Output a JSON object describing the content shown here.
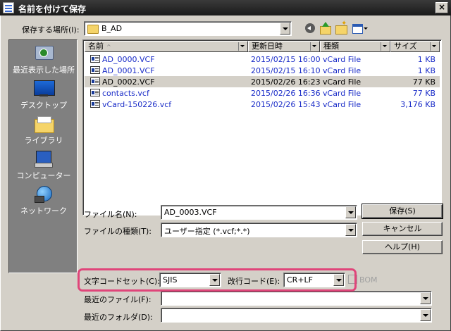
{
  "window": {
    "title": "名前を付けて保存",
    "close_glyph": "×"
  },
  "location": {
    "label": "保存する場所(I):",
    "value": "B_AD"
  },
  "places": [
    {
      "label": "最近表示した場所",
      "icon": "recent-places-icon"
    },
    {
      "label": "デスクトップ",
      "icon": "desktop-icon"
    },
    {
      "label": "ライブラリ",
      "icon": "library-icon"
    },
    {
      "label": "コンピューター",
      "icon": "computer-icon"
    },
    {
      "label": "ネットワーク",
      "icon": "network-icon"
    }
  ],
  "columns": {
    "name": "名前",
    "sort_glyph": "^",
    "modified": "更新日時",
    "type": "種類",
    "size": "サイズ"
  },
  "files": [
    {
      "name": "AD_0000.VCF",
      "modified": "2015/02/15 16:00",
      "type": "vCard File",
      "size": "1 KB",
      "selected": false
    },
    {
      "name": "AD_0001.VCF",
      "modified": "2015/02/15 16:10",
      "type": "vCard File",
      "size": "1 KB",
      "selected": false
    },
    {
      "name": "AD_0002.VCF",
      "modified": "2015/02/26 16:23",
      "type": "vCard File",
      "size": "77 KB",
      "selected": true
    },
    {
      "name": "contacts.vcf",
      "modified": "2015/02/26 16:36",
      "type": "vCard File",
      "size": "77 KB",
      "selected": false
    },
    {
      "name": "vCard-150226.vcf",
      "modified": "2015/02/26 15:43",
      "type": "vCard File",
      "size": "3,176 KB",
      "selected": false
    }
  ],
  "filename": {
    "label": "ファイル名(N):",
    "value": "AD_0003.VCF"
  },
  "filetype": {
    "label": "ファイルの種類(T):",
    "value": "ユーザー指定 (*.vcf;*.*)"
  },
  "buttons": {
    "save": "保存(S)",
    "cancel": "キャンセル",
    "help": "ヘルプ(H)"
  },
  "encoding": {
    "label": "文字コードセット(C):",
    "value": "SJIS"
  },
  "newline": {
    "label": "改行コード(E):",
    "value": "CR+LF"
  },
  "bom": {
    "label": "BOM",
    "checked": false
  },
  "recent_files": {
    "label": "最近のファイル(F):",
    "value": ""
  },
  "recent_folders": {
    "label": "最近のフォルダ(D):",
    "value": ""
  },
  "colors": {
    "highlight": "#e0457a",
    "file_text": "#1a2cc8",
    "places_bg": "#808080"
  }
}
